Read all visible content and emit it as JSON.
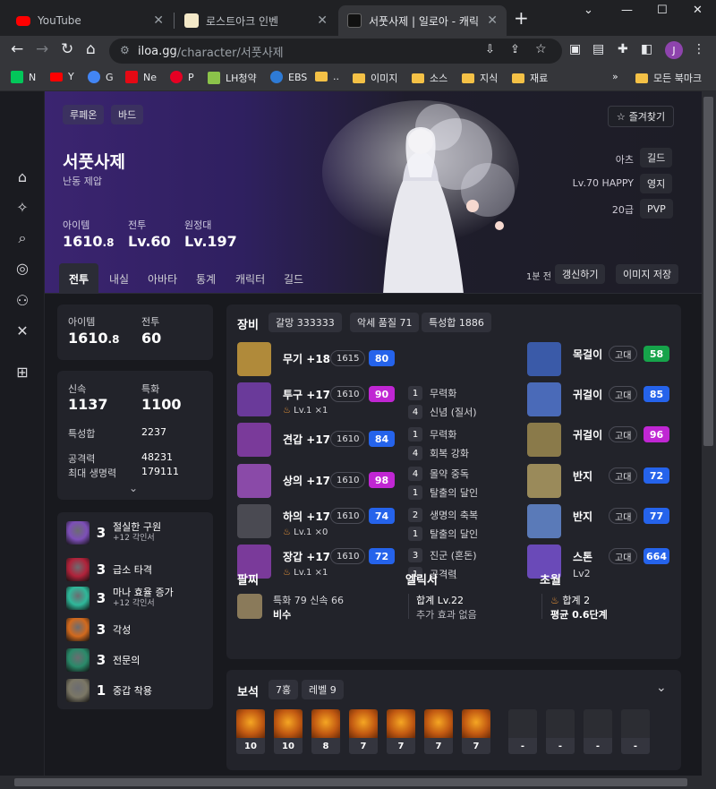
{
  "browser": {
    "tabs": [
      {
        "label": "YouTube"
      },
      {
        "label": "로스트아크 인벤"
      },
      {
        "label": "서풋사제 | 일로아 - 캐릭터"
      }
    ],
    "url_host": "iloa.gg",
    "url_path": "/character/서풋사제",
    "profile_initial": "J",
    "bookmarks": [
      "N",
      "Y",
      "G",
      "Ne",
      "P",
      "LH청약",
      "EBS",
      "..",
      "이미지",
      "소스",
      "지식",
      "재료"
    ],
    "bookmarks_overflow": "»",
    "all_bookmarks": "모든 북마크"
  },
  "hero": {
    "tags": [
      "루페온",
      "바드"
    ],
    "name": "서풋사제",
    "subtitle": "난동 제압",
    "stats": [
      {
        "label": "아이템",
        "value": "1610",
        "decimal": ".8"
      },
      {
        "label": "전투",
        "value": "Lv.60",
        "decimal": ""
      },
      {
        "label": "원정대",
        "value": "Lv.197",
        "decimal": ""
      }
    ],
    "favorite": "즐겨찾기",
    "guild_label": "아츠",
    "guild_chip": "길드",
    "territory_label": "Lv.70 HAPPY",
    "territory_chip": "영지",
    "pvp_label": "20급",
    "pvp_chip": "PVP"
  },
  "tabs": {
    "items": [
      "전투",
      "내실",
      "아바타",
      "통계",
      "캐릭터",
      "길드"
    ],
    "updated": "1분 전",
    "refresh": "갱신하기",
    "save_image": "이미지 저장"
  },
  "summary": {
    "item_label": "아이템",
    "item_value": "1610",
    "item_decimal": ".8",
    "combat_label": "전투",
    "combat_value": "60"
  },
  "stats": {
    "swift_label": "신속",
    "swift_value": "1137",
    "crit_label": "특화",
    "crit_value": "1100",
    "total_label": "특성합",
    "total_value": "2237",
    "attack_label": "공격력",
    "attack_value": "48231",
    "hp_label": "최대 생명력",
    "hp_value": "179111"
  },
  "engravings": [
    {
      "level": "3",
      "name": "절실한 구원",
      "sub": "+12 각인서",
      "color": "#7d4fb8"
    },
    {
      "level": "3",
      "name": "급소 타격",
      "sub": "",
      "color": "#b0223a"
    },
    {
      "level": "3",
      "name": "마나 효율 증가",
      "sub": "+12 각인서",
      "color": "#2fb89a"
    },
    {
      "level": "3",
      "name": "각성",
      "sub": "",
      "color": "#d26a1e"
    },
    {
      "level": "3",
      "name": "전문의",
      "sub": "",
      "color": "#2a8a6a"
    },
    {
      "level": "1",
      "name": "중갑 착용",
      "sub": "",
      "color": "#7b7766"
    }
  ],
  "equipment": {
    "title": "장비",
    "chips": [
      "갈망 333333",
      "악세 품질 71",
      "특성합 1886"
    ],
    "gear": [
      {
        "name": "무기 +18",
        "level": "1615",
        "quality": "80",
        "qcolor": "#2563eb",
        "refine": "",
        "icon": "#b08a3a"
      },
      {
        "name": "투구 +17",
        "level": "1610",
        "quality": "90",
        "qcolor": "#c026d3",
        "refine": "Lv.1 ×1",
        "icon": "#6a3a9a"
      },
      {
        "name": "견갑 +17",
        "level": "1610",
        "quality": "84",
        "qcolor": "#2563eb",
        "refine": "",
        "icon": "#7a3a9a"
      },
      {
        "name": "상의 +17",
        "level": "1610",
        "quality": "98",
        "qcolor": "#c026d3",
        "refine": "",
        "icon": "#8a4aa8"
      },
      {
        "name": "하의 +17",
        "level": "1610",
        "quality": "74",
        "qcolor": "#2563eb",
        "refine": "Lv.1 ×0",
        "icon": "#4a4a52"
      },
      {
        "name": "장갑 +17",
        "level": "1610",
        "quality": "72",
        "qcolor": "#2563eb",
        "refine": "Lv.1 ×1",
        "icon": "#7a3a9a"
      }
    ],
    "stones": [
      {
        "num": "1",
        "text": "무력화"
      },
      {
        "num": "4",
        "text": "신념 (질서)"
      },
      {
        "num": "1",
        "text": "무력화"
      },
      {
        "num": "4",
        "text": "회복 강화"
      },
      {
        "num": "4",
        "text": "몰약 중독"
      },
      {
        "num": "1",
        "text": "탈출의 달인"
      },
      {
        "num": "2",
        "text": "생명의 축복"
      },
      {
        "num": "1",
        "text": "탈출의 달인"
      },
      {
        "num": "3",
        "text": "진군 (혼돈)"
      },
      {
        "num": "1",
        "text": "공격력"
      }
    ],
    "accessories": [
      {
        "name": "목걸이",
        "grade": "고대",
        "quality": "58",
        "qcolor": "#16a34a",
        "icon": "#3a5aa8"
      },
      {
        "name": "귀걸이",
        "grade": "고대",
        "quality": "85",
        "qcolor": "#2563eb",
        "icon": "#4a6ab8"
      },
      {
        "name": "귀걸이",
        "grade": "고대",
        "quality": "96",
        "qcolor": "#c026d3",
        "icon": "#8a7a4a"
      },
      {
        "name": "반지",
        "grade": "고대",
        "quality": "72",
        "qcolor": "#2563eb",
        "icon": "#9a8a5a"
      },
      {
        "name": "반지",
        "grade": "고대",
        "quality": "77",
        "qcolor": "#2563eb",
        "icon": "#5a7ab8"
      },
      {
        "name": "스톤",
        "grade": "고대",
        "quality": "664",
        "qcolor": "#2563eb",
        "icon": "#6a4ab8",
        "sub": "Lv2"
      }
    ],
    "bracelet_title": "팔찌",
    "bracelet_stats": "특화 79  신속 66",
    "bracelet_grade": "비수",
    "elixir_title": "엘릭서",
    "elixir_dash": "—",
    "elixir_total": "합계 Lv.22",
    "elixir_effect": "추가 효과 없음",
    "transcend_title": "초월",
    "transcend_total": "합계 2",
    "transcend_avg": "평균 0.6단계"
  },
  "gems": {
    "title": "보석",
    "count_chip": "7홍",
    "level_chip": "레벨 9",
    "items": [
      "10",
      "10",
      "8",
      "7",
      "7",
      "7",
      "7",
      "-",
      "-",
      "-",
      "-"
    ]
  }
}
